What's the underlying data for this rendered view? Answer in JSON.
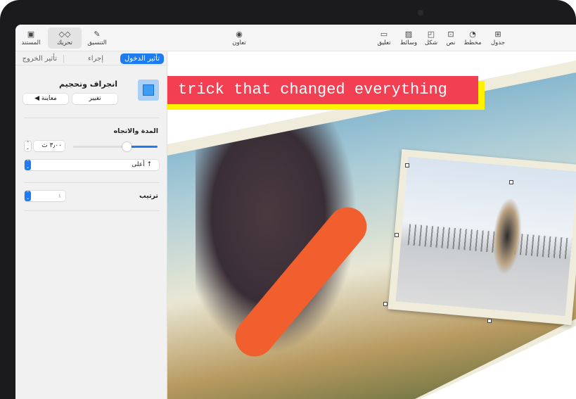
{
  "toolbar": {
    "left": [
      {
        "label": "المستند",
        "icon": "document-icon"
      },
      {
        "label": "تحريك",
        "icon": "animate-icon",
        "active": true
      },
      {
        "label": "التنسيق",
        "icon": "format-brush-icon"
      }
    ],
    "center": {
      "label": "تعاون",
      "icon": "collaborate-icon"
    },
    "right": [
      {
        "label": "تعليق",
        "icon": "comment-icon"
      },
      {
        "label": "وسائط",
        "icon": "media-icon"
      },
      {
        "label": "شكل",
        "icon": "shape-icon"
      },
      {
        "label": "نص",
        "icon": "text-icon"
      },
      {
        "label": "مخطط",
        "icon": "chart-icon"
      },
      {
        "label": "جدول",
        "icon": "table-icon"
      }
    ]
  },
  "sidebar": {
    "tabs": [
      "تأثير الدخول",
      "إجراء",
      "تأثير الخروج"
    ],
    "effect_title": "انجراف وتحجيم",
    "change_button": "تغيير",
    "preview_button": "معاينة",
    "duration_heading": "المدة والاتجاه",
    "duration_value": "٣٫٠٠ ث",
    "duration_slider_fraction": 0.36,
    "direction_value": "أعلى",
    "order_label": "ترتيب",
    "order_value": "١"
  },
  "canvas": {
    "title_text": "trick that changed everything",
    "colors": {
      "title_bg": "#f23f52",
      "title_shadow": "#fff200",
      "accent": "#1e7cf2"
    }
  }
}
